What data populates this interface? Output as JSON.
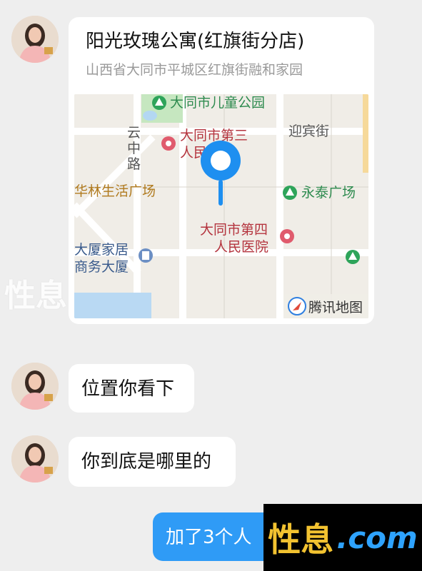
{
  "messages": [
    {
      "type": "location",
      "title": "阳光玫瑰公寓(红旗街分店)",
      "address": "山西省大同市平城区红旗街融和家园",
      "map": {
        "labels": {
          "park": "大同市儿童公园",
          "hospital3_a": "大同市第三",
          "hospital3_b": "人民医院",
          "street_yingbin": "迎宾街",
          "yunzhong_1": "云",
          "yunzhong_2": "中",
          "yunzhong_3": "路",
          "hualin": "华林生活广场",
          "yongtai": "永泰广场",
          "hospital4_a": "大同市第四",
          "hospital4_b": "人民医院",
          "dasha_a": "大厦家居",
          "dasha_b": "商务大厦",
          "provider": "腾讯地图"
        }
      }
    },
    {
      "type": "text",
      "text": "位置你看下"
    },
    {
      "type": "text",
      "text": "你到底是哪里的"
    },
    {
      "type": "text",
      "direction": "out",
      "text": "加了3个人"
    }
  ],
  "watermark": {
    "brand": "性息",
    "domain": ".com"
  },
  "colors": {
    "outgoing_bubble": "#2f9bf6",
    "incoming_bubble": "#ffffff",
    "background": "#eeeeee",
    "pin": "#1e8ff0"
  }
}
